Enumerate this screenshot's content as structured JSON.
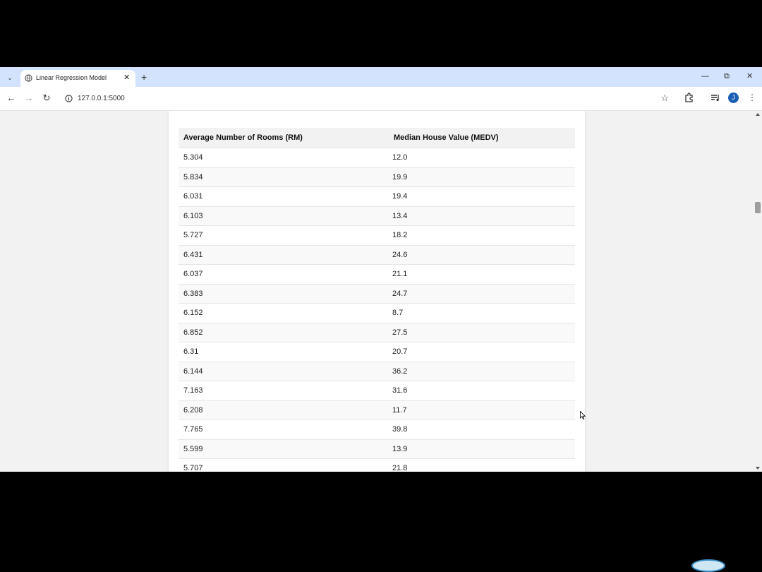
{
  "browser": {
    "tab_title": "Linear Regression Model",
    "new_tab_label": "+",
    "url": "127.0.0.1:5000",
    "profile_initial": "J",
    "icons": [
      "tab-search-icon",
      "globe-icon",
      "close-icon",
      "plus-icon",
      "minimize-icon",
      "restore-icon",
      "window-close-icon",
      "back-icon",
      "forward-icon",
      "reload-icon",
      "info-icon",
      "star-icon",
      "extensions-icon",
      "media-queue-icon",
      "kebab-menu-icon"
    ]
  },
  "table": {
    "headers": [
      "Average Number of Rooms (RM)",
      "Median House Value (MEDV)"
    ],
    "rows": [
      [
        "5.304",
        "12.0"
      ],
      [
        "5.834",
        "19.9"
      ],
      [
        "6.031",
        "19.4"
      ],
      [
        "6.103",
        "13.4"
      ],
      [
        "5.727",
        "18.2"
      ],
      [
        "6.431",
        "24.6"
      ],
      [
        "6.037",
        "21.1"
      ],
      [
        "6.383",
        "24.7"
      ],
      [
        "6.152",
        "8.7"
      ],
      [
        "6.852",
        "27.5"
      ],
      [
        "6.31",
        "20.7"
      ],
      [
        "6.144",
        "36.2"
      ],
      [
        "7.163",
        "31.6"
      ],
      [
        "6.208",
        "11.7"
      ],
      [
        "7.765",
        "39.8"
      ],
      [
        "5.599",
        "13.9"
      ],
      [
        "5.707",
        "21.8"
      ]
    ]
  },
  "colors": {
    "tabstrip": "#d3e3fd",
    "page_background": "#f2f2f2",
    "header_row": "#f2f2f2",
    "avatar": "#1a5fb4"
  }
}
